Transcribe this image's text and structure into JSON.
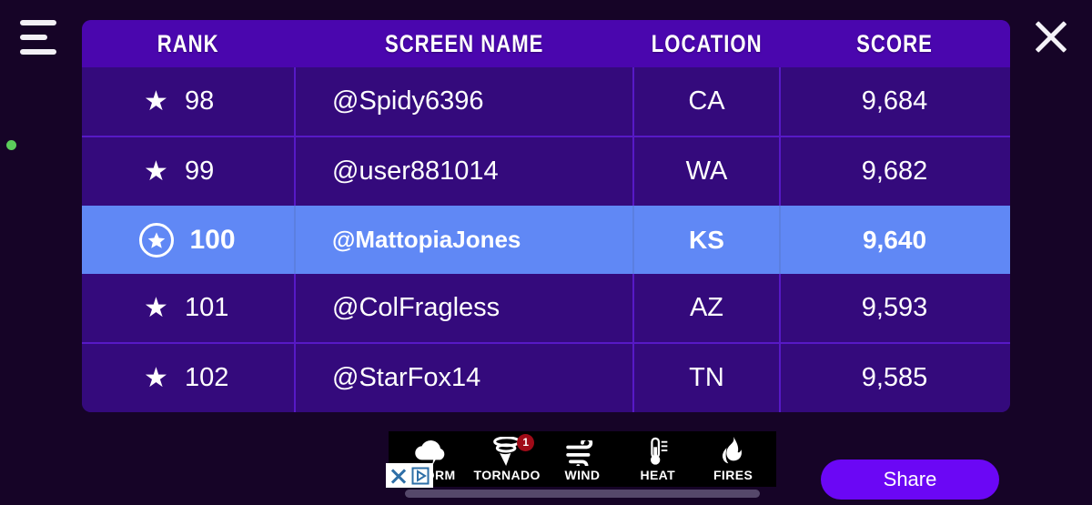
{
  "window": {
    "background_color": "#160427",
    "menu_icon": "hamburger-menu-icon",
    "close_icon": "close-icon",
    "status_dot_color": "#5bcc5b"
  },
  "leaderboard": {
    "accent_header_color": "#4A06AE",
    "row_color": "#340A7C",
    "highlight_color": "#6088F5",
    "columns": [
      {
        "key": "rank",
        "label": "RANK"
      },
      {
        "key": "name",
        "label": "SCREEN NAME"
      },
      {
        "key": "location",
        "label": "LOCATION"
      },
      {
        "key": "score",
        "label": "SCORE"
      }
    ],
    "rows": [
      {
        "star": "star-icon",
        "rank": "98",
        "name": "@Spidy6396",
        "location": "CA",
        "score": "9,684",
        "highlighted": false
      },
      {
        "star": "star-icon",
        "rank": "99",
        "name": "@user881014",
        "location": "WA",
        "score": "9,682",
        "highlighted": false
      },
      {
        "star": "star-badge-icon",
        "rank": "100",
        "name": "@MattopiaJones",
        "location": "KS",
        "score": "9,640",
        "highlighted": true
      },
      {
        "star": "star-icon",
        "rank": "101",
        "name": "@ColFragless",
        "location": "AZ",
        "score": "9,593",
        "highlighted": false
      },
      {
        "star": "star-icon",
        "rank": "102",
        "name": "@StarFox14",
        "location": "TN",
        "score": "9,585",
        "highlighted": false
      }
    ]
  },
  "ad": {
    "items": [
      {
        "icon": "storm-cloud-lightning-icon",
        "label": "STORM",
        "badge": ""
      },
      {
        "icon": "tornado-icon",
        "label": "TORNADO",
        "badge": "1"
      },
      {
        "icon": "wind-icon",
        "label": "WIND",
        "badge": ""
      },
      {
        "icon": "thermometer-icon",
        "label": "HEAT",
        "badge": ""
      },
      {
        "icon": "fire-icon",
        "label": "FIRES",
        "badge": ""
      }
    ],
    "close_icon": "ad-close-icon",
    "adchoices_icon": "adchoices-icon"
  },
  "share": {
    "label": "Share",
    "color": "#6B07F5"
  }
}
